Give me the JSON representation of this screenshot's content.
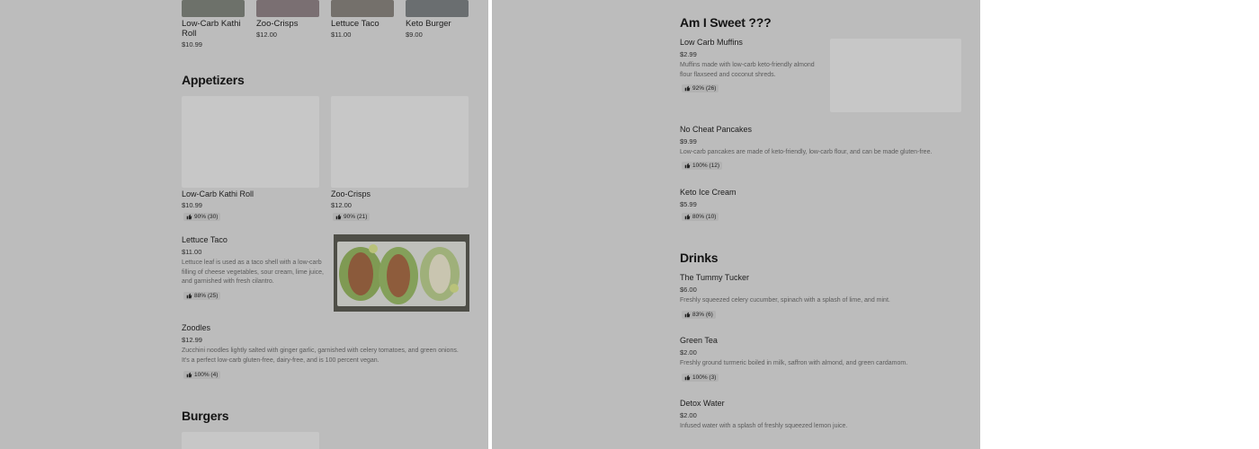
{
  "top_row": [
    {
      "name": "Low-Carb Kathi Roll",
      "price": "$10.99"
    },
    {
      "name": "Zoo-Crisps",
      "price": "$12.00"
    },
    {
      "name": "Lettuce Taco",
      "price": "$11.00"
    },
    {
      "name": "Keto Burger",
      "price": "$9.00"
    }
  ],
  "appetizers": {
    "title": "Appetizers",
    "cards": [
      {
        "name": "Low-Carb Kathi Roll",
        "price": "$10.99",
        "rating": "90% (30)"
      },
      {
        "name": "Zoo-Crisps",
        "price": "$12.00",
        "rating": "90% (21)"
      }
    ],
    "items": [
      {
        "name": "Lettuce Taco",
        "price": "$11.00",
        "description": "Lettuce leaf is used as a taco shell with a low-carb filling of cheese vegetables, sour cream, lime juice, and garnished with fresh cilantro.",
        "rating": "88% (25)"
      },
      {
        "name": "Zoodles",
        "price": "$12.99",
        "description": "Zucchini noodles lightly salted with ginger garlic, garnished with celery tomatoes, and green onions. It's a perfect low-carb gluten-free, dairy-free, and is 100 percent vegan.",
        "rating": "100% (4)"
      }
    ]
  },
  "burgers": {
    "title": "Burgers"
  },
  "am_i_sweet": {
    "title": "Am I Sweet ???",
    "items": [
      {
        "name": "Low Carb Muffins",
        "price": "$2.99",
        "description": "Muffins made with low-carb keto-friendly almond flour flaxseed and coconut shreds.",
        "rating": "92% (26)"
      },
      {
        "name": "No Cheat Pancakes",
        "price": "$9.99",
        "description": "Low-carb pancakes are made of keto-friendly, low-carb flour, and can be made gluten-free.",
        "rating": "100% (12)"
      },
      {
        "name": "Keto Ice Cream",
        "price": "$5.99",
        "description": "",
        "rating": "80% (10)"
      }
    ]
  },
  "drinks": {
    "title": "Drinks",
    "items": [
      {
        "name": "The Tummy Tucker",
        "price": "$6.00",
        "description": "Freshly squeezed celery cucumber, spinach with a splash of lime, and mint.",
        "rating": "83% (6)"
      },
      {
        "name": "Green Tea",
        "price": "$2.00",
        "description": "Freshly ground turmeric boiled in milk, saffron with almond, and green cardamom.",
        "rating": "100% (3)"
      },
      {
        "name": "Detox Water",
        "price": "$2.00",
        "description": "Infused water with a splash of freshly squeezed lemon juice.",
        "rating": ""
      }
    ]
  },
  "icons": {
    "rating": "thumbs-up-icon"
  },
  "colors": {
    "overlay": "#bcbcbc",
    "card": "#c7c7c7"
  }
}
